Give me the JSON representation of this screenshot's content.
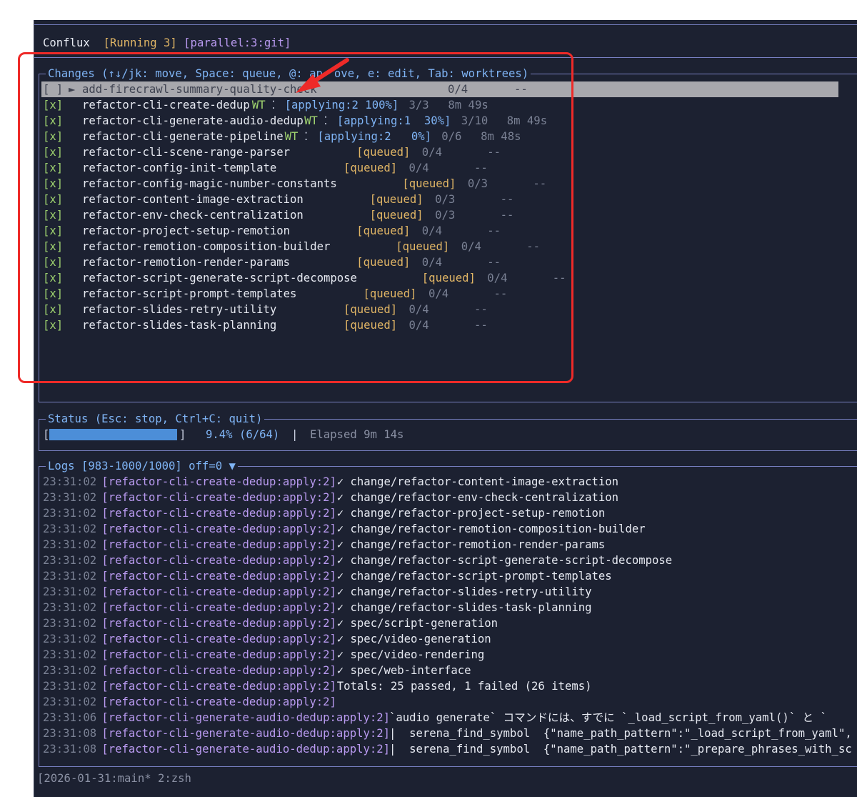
{
  "header": {
    "app_name": "Conflux",
    "running": "[Running 3]",
    "mode": "[parallel:3:git]"
  },
  "changes_panel": {
    "title": "Changes (↑↓/jk: move, Space: queue, @: approve, e: edit, Tab: worktrees)",
    "title_visible": "Changes (↑↓/jk: move, Space: queue, @: ap",
    "title_after_arrow": "ove, e: edit, Tab: worktrees)",
    "selected": {
      "check": "[ ]",
      "pointer": "►",
      "name": "add-firecrawl-summary-quality-check",
      "progress": "0/4",
      "time": "--"
    },
    "rows": [
      {
        "check": "[x]",
        "name": "refactor-cli-create-dedup",
        "wt": "WT",
        "dots": "⁚",
        "status": "[applying:2 100%]",
        "progress": "3/3",
        "time": "8m 49s"
      },
      {
        "check": "[x]",
        "name": "refactor-cli-generate-audio-dedup",
        "wt": "WT",
        "dots": "⁚",
        "status": "[applying:1  30%]",
        "progress": "3/10",
        "time": "8m 49s"
      },
      {
        "check": "[x]",
        "name": "refactor-cli-generate-pipeline",
        "wt": "WT",
        "dots": "⁚",
        "status": "[applying:2   0%]",
        "progress": "0/6",
        "time": "8m 48s"
      },
      {
        "check": "[x]",
        "name": "refactor-cli-scene-range-parser",
        "status": "[queued]",
        "progress": "0/4",
        "time": "--"
      },
      {
        "check": "[x]",
        "name": "refactor-config-init-template",
        "status": "[queued]",
        "progress": "0/4",
        "time": "--"
      },
      {
        "check": "[x]",
        "name": "refactor-config-magic-number-constants",
        "status": "[queued]",
        "progress": "0/3",
        "time": "--"
      },
      {
        "check": "[x]",
        "name": "refactor-content-image-extraction",
        "status": "[queued]",
        "progress": "0/3",
        "time": "--"
      },
      {
        "check": "[x]",
        "name": "refactor-env-check-centralization",
        "status": "[queued]",
        "progress": "0/3",
        "time": "--"
      },
      {
        "check": "[x]",
        "name": "refactor-project-setup-remotion",
        "status": "[queued]",
        "progress": "0/4",
        "time": "--"
      },
      {
        "check": "[x]",
        "name": "refactor-remotion-composition-builder",
        "status": "[queued]",
        "progress": "0/4",
        "time": "--"
      },
      {
        "check": "[x]",
        "name": "refactor-remotion-render-params",
        "status": "[queued]",
        "progress": "0/4",
        "time": "--"
      },
      {
        "check": "[x]",
        "name": "refactor-script-generate-script-decompose",
        "status": "[queued]",
        "progress": "0/4",
        "time": "--"
      },
      {
        "check": "[x]",
        "name": "refactor-script-prompt-templates",
        "status": "[queued]",
        "progress": "0/4",
        "time": "--"
      },
      {
        "check": "[x]",
        "name": "refactor-slides-retry-utility",
        "status": "[queued]",
        "progress": "0/4",
        "time": "--"
      },
      {
        "check": "[x]",
        "name": "refactor-slides-task-planning",
        "status": "[queued]",
        "progress": "0/4",
        "time": "--"
      }
    ]
  },
  "status_panel": {
    "title": "Status (Esc: stop, Ctrl+C: quit)",
    "bar_open": "[",
    "bar_close": "]",
    "progress_fraction": 0.094,
    "percent": "9.4% (6/64)",
    "separator": "|",
    "elapsed": "Elapsed 9m 14s"
  },
  "logs_panel": {
    "title": "Logs [983-1000/1000] off=0 ▼",
    "entries": [
      {
        "time": "23:31:02",
        "tag": "[refactor-cli-create-dedup:apply:2]",
        "msg": "✓ change/refactor-content-image-extraction"
      },
      {
        "time": "23:31:02",
        "tag": "[refactor-cli-create-dedup:apply:2]",
        "msg": "✓ change/refactor-env-check-centralization"
      },
      {
        "time": "23:31:02",
        "tag": "[refactor-cli-create-dedup:apply:2]",
        "msg": "✓ change/refactor-project-setup-remotion"
      },
      {
        "time": "23:31:02",
        "tag": "[refactor-cli-create-dedup:apply:2]",
        "msg": "✓ change/refactor-remotion-composition-builder"
      },
      {
        "time": "23:31:02",
        "tag": "[refactor-cli-create-dedup:apply:2]",
        "msg": "✓ change/refactor-remotion-render-params"
      },
      {
        "time": "23:31:02",
        "tag": "[refactor-cli-create-dedup:apply:2]",
        "msg": "✓ change/refactor-script-generate-script-decompose"
      },
      {
        "time": "23:31:02",
        "tag": "[refactor-cli-create-dedup:apply:2]",
        "msg": "✓ change/refactor-script-prompt-templates"
      },
      {
        "time": "23:31:02",
        "tag": "[refactor-cli-create-dedup:apply:2]",
        "msg": "✓ change/refactor-slides-retry-utility"
      },
      {
        "time": "23:31:02",
        "tag": "[refactor-cli-create-dedup:apply:2]",
        "msg": "✓ change/refactor-slides-task-planning"
      },
      {
        "time": "23:31:02",
        "tag": "[refactor-cli-create-dedup:apply:2]",
        "msg": "✓ spec/script-generation"
      },
      {
        "time": "23:31:02",
        "tag": "[refactor-cli-create-dedup:apply:2]",
        "msg": "✓ spec/video-generation"
      },
      {
        "time": "23:31:02",
        "tag": "[refactor-cli-create-dedup:apply:2]",
        "msg": "✓ spec/video-rendering"
      },
      {
        "time": "23:31:02",
        "tag": "[refactor-cli-create-dedup:apply:2]",
        "msg": "✓ spec/web-interface"
      },
      {
        "time": "23:31:02",
        "tag": "[refactor-cli-create-dedup:apply:2]",
        "msg": "Totals: 25 passed, 1 failed (26 items)"
      },
      {
        "time": "23:31:02",
        "tag": "[refactor-cli-create-dedup:apply:2]",
        "msg": ""
      },
      {
        "time": "23:31:06",
        "tag": "[refactor-cli-generate-audio-dedup:apply:2]",
        "msg": "`audio generate` コマンドには、すでに `_load_script_from_yaml()` と `"
      },
      {
        "time": "23:31:08",
        "tag": "[refactor-cli-generate-audio-dedup:apply:2]",
        "msg": "|  serena_find_symbol  {\"name_path_pattern\":\"_load_script_from_yaml\","
      },
      {
        "time": "23:31:08",
        "tag": "[refactor-cli-generate-audio-dedup:apply:2]",
        "msg": "|  serena_find_symbol  {\"name_path_pattern\":\"_prepare_phrases_with_sc"
      }
    ]
  },
  "tmux_status": "[2026-01-31:main* 2:zsh",
  "annotation": {
    "color": "#ee2a28"
  }
}
